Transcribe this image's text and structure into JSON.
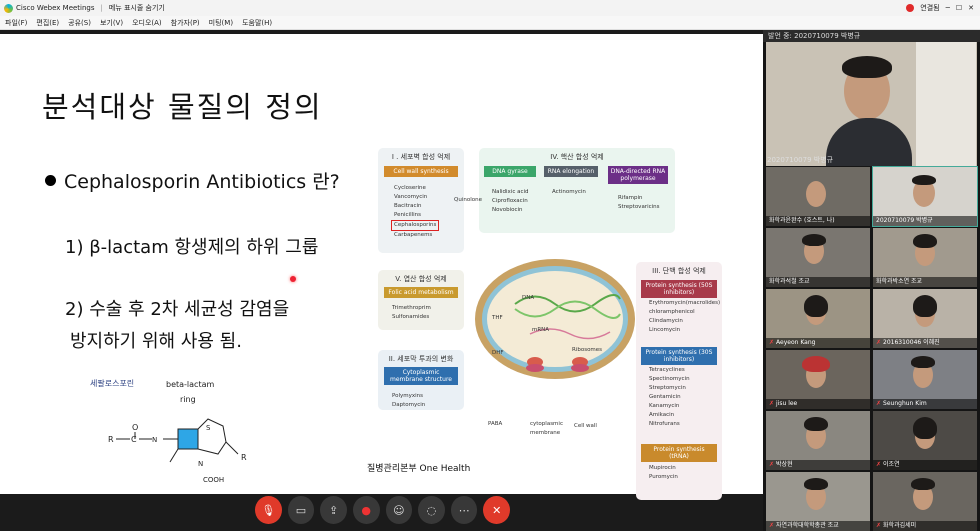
{
  "app": {
    "title": "Cisco Webex Meetings",
    "menu_hint": "메뉴 표시줄 숨기기",
    "status": "연결됨"
  },
  "menu": [
    "파일(F)",
    "편집(E)",
    "공유(S)",
    "보기(V)",
    "오디오(A)",
    "참가자(P)",
    "미팅(M)",
    "도움말(H)"
  ],
  "slide": {
    "title": "분석대상 물질의 정의",
    "bullet": "Cephalosporin Antibiotics 란?",
    "sub1": "1) β-lactam 항생제의 하위 그룹",
    "sub2_line1": "2) 수술 후 2차 세균성 감염을",
    "sub2_line2": "방지하기 위해 사용 됨.",
    "chem_label": "세팔로스포린",
    "chem_ring": "beta-lactam",
    "chem_ring2": "ring",
    "credit": "질병관리본부 One Health"
  },
  "diagram": {
    "g1": {
      "title": "I . 세포벽 합성 억제",
      "tag": "Cell wall synthesis",
      "items": [
        "Cycloserine",
        "Vancomycin",
        "Bacitracin",
        "Penicillins",
        "Cephalosporins",
        "Carbapenems"
      ]
    },
    "g2": {
      "title": "IV. 핵산 합성 억제",
      "tags": [
        "DNA gyrase",
        "RNA elongation",
        "DNA-directed RNA polymerase"
      ],
      "quinolone": "Quinolone",
      "c1": [
        "Nalidixic acid",
        "Ciprofloxacin",
        "Novobiocin"
      ],
      "c2": [
        "Actinomycin"
      ],
      "c3": [
        "Rifampin",
        "Streptovaricins"
      ]
    },
    "g3": {
      "title": "V. 엽산 합성 억제",
      "tag": "Folic acid metabolism",
      "items": [
        "Trimethroprim",
        "Sulfonamides"
      ]
    },
    "g4": {
      "title": "II. 세포막 투과의 변화",
      "tag": "Cytoplasmic membrane structure",
      "items": [
        "Polymyxins",
        "Daptomycin"
      ]
    },
    "g5": {
      "title": "III. 단백 합성 억제",
      "tag1": "Protein synthesis (50S inhibitors)",
      "items1": [
        "Erythromycin(macrolides)",
        "chloramphenicol",
        "Clindamycin",
        "Lincomycin"
      ],
      "tag2": "Protein synthesis (30S inhibitors)",
      "items2": [
        "Tetracyclines",
        "Spectinomycin",
        "Streptomycin",
        "Gentamicin",
        "Kanamycin",
        "Amikacin",
        "Nitrofurans"
      ],
      "tag3": "Protein synthesis (tRNA)",
      "items3": [
        "Mupirocin",
        "Puromycin"
      ]
    },
    "cell": {
      "dna": "DNA",
      "mrna": "mRNA",
      "thf": "THF",
      "dhf": "DHF",
      "paba": "PABA",
      "ribosomes": "Ribosomes",
      "r50": "50",
      "r30": "30",
      "membrane": "cytoplasmic membrane",
      "wall": "Cell wall"
    }
  },
  "panel": {
    "active_speaker": "발언 중: 2020710079 박병규",
    "speaker_name": "2020710079 박병규",
    "tiles": [
      "화학과윤완수 (호스트, 나)",
      "2020710079 박병규",
      "화학과석철 조교",
      "화학과박소연 조교",
      "Aeyeon Kang",
      "2016310046 이혜진",
      "jisu lee",
      "Seunghun Kim",
      "박상현",
      "이조연",
      "자연과학대학학총관 조교",
      "화학과김세미"
    ]
  },
  "colors": {
    "accent": "#e03a2a"
  }
}
